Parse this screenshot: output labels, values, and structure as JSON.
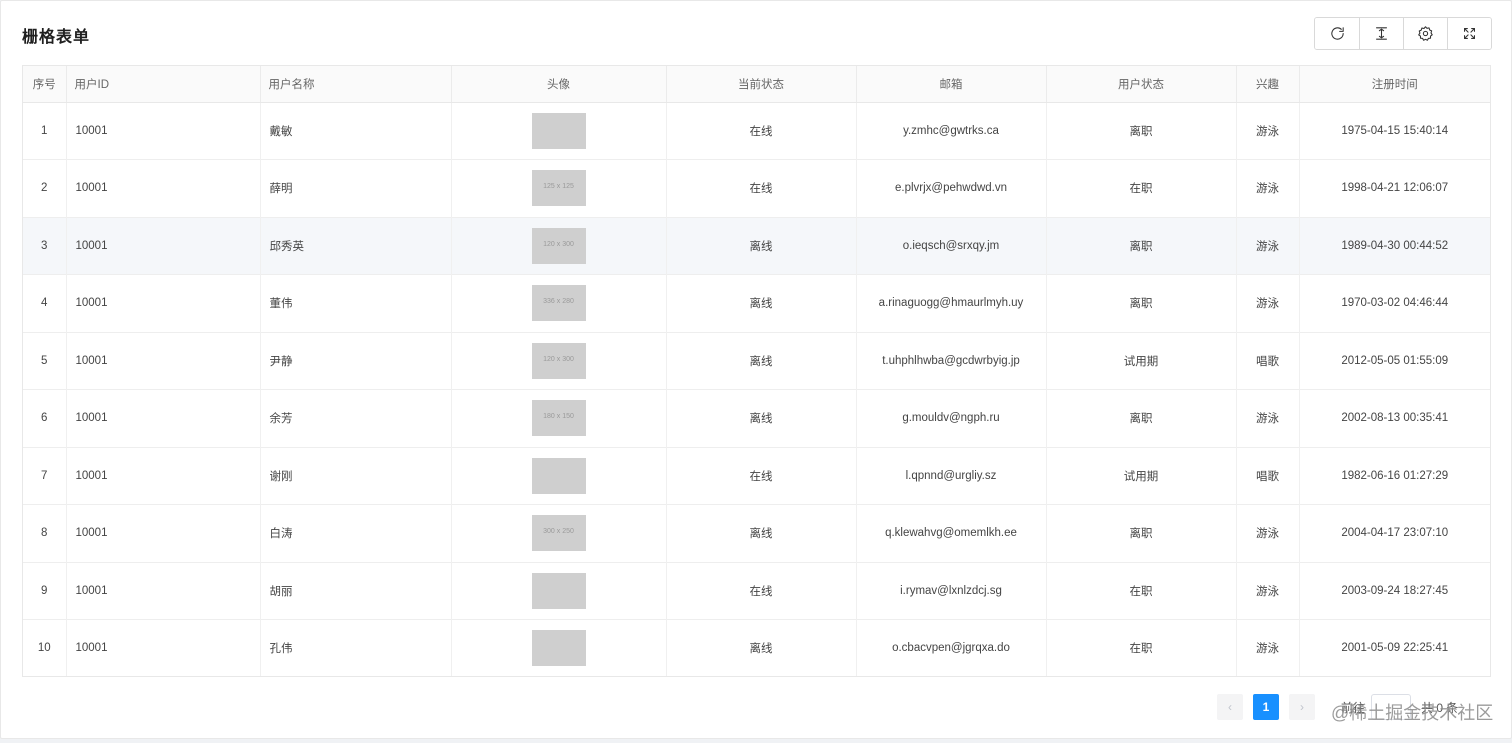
{
  "title": "栅格表单",
  "toolbar": {
    "refresh_icon": "refresh-icon",
    "density_icon": "column-height-icon",
    "settings_icon": "gear-icon",
    "fullscreen_icon": "fullscreen-icon"
  },
  "table": {
    "columns": [
      "序号",
      "用户ID",
      "用户名称",
      "头像",
      "当前状态",
      "邮箱",
      "用户状态",
      "兴趣",
      "注册时间"
    ],
    "rows": [
      {
        "index": "1",
        "uid": "10001",
        "name": "戴敏",
        "avatar_text": "",
        "online": "在线",
        "email": "y.zmhc@gwtrks.ca",
        "status": "离职",
        "hobby": "游泳",
        "time": "1975-04-15 15:40:14"
      },
      {
        "index": "2",
        "uid": "10001",
        "name": "薛明",
        "avatar_text": "125 x 125",
        "online": "在线",
        "email": "e.plvrjx@pehwdwd.vn",
        "status": "在职",
        "hobby": "游泳",
        "time": "1998-04-21 12:06:07"
      },
      {
        "index": "3",
        "uid": "10001",
        "name": "邱秀英",
        "avatar_text": "120 x 300",
        "online": "离线",
        "email": "o.ieqsch@srxqy.jm",
        "status": "离职",
        "hobby": "游泳",
        "time": "1989-04-30 00:44:52"
      },
      {
        "index": "4",
        "uid": "10001",
        "name": "董伟",
        "avatar_text": "336 x 280",
        "online": "离线",
        "email": "a.rinaguogg@hmaurlmyh.uy",
        "status": "离职",
        "hobby": "游泳",
        "time": "1970-03-02 04:46:44"
      },
      {
        "index": "5",
        "uid": "10001",
        "name": "尹静",
        "avatar_text": "120 x 300",
        "online": "离线",
        "email": "t.uhphlhwba@gcdwrbyig.jp",
        "status": "试用期",
        "hobby": "唱歌",
        "time": "2012-05-05 01:55:09"
      },
      {
        "index": "6",
        "uid": "10001",
        "name": "余芳",
        "avatar_text": "180 x 150",
        "online": "离线",
        "email": "g.mouldv@ngph.ru",
        "status": "离职",
        "hobby": "游泳",
        "time": "2002-08-13 00:35:41"
      },
      {
        "index": "7",
        "uid": "10001",
        "name": "谢刚",
        "avatar_text": "",
        "online": "在线",
        "email": "l.qpnnd@urgliy.sz",
        "status": "试用期",
        "hobby": "唱歌",
        "time": "1982-06-16 01:27:29"
      },
      {
        "index": "8",
        "uid": "10001",
        "name": "白涛",
        "avatar_text": "300 x 250",
        "online": "离线",
        "email": "q.klewahvg@omemlkh.ee",
        "status": "离职",
        "hobby": "游泳",
        "time": "2004-04-17 23:07:10"
      },
      {
        "index": "9",
        "uid": "10001",
        "name": "胡丽",
        "avatar_text": "",
        "online": "在线",
        "email": "i.rymav@lxnlzdcj.sg",
        "status": "在职",
        "hobby": "游泳",
        "time": "2003-09-24 18:27:45"
      },
      {
        "index": "10",
        "uid": "10001",
        "name": "孔伟",
        "avatar_text": "",
        "online": "离线",
        "email": "o.cbacvpen@jgrqxa.do",
        "status": "在职",
        "hobby": "游泳",
        "time": "2001-05-09 22:25:41"
      }
    ]
  },
  "pagination": {
    "prev": "‹",
    "current": "1",
    "next": "›",
    "goto_label": "前往",
    "total_text": "共 0 条"
  },
  "watermark": "@稀土掘金技术社区"
}
